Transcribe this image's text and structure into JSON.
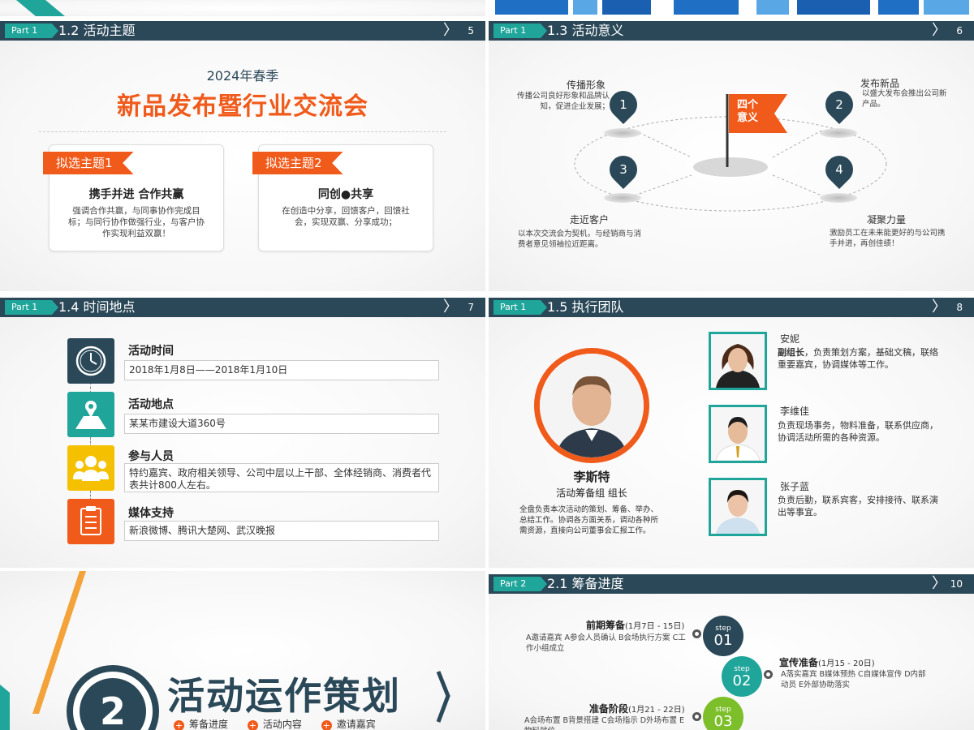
{
  "header_common": {
    "part1": "Part 1",
    "part2": "Part 2"
  },
  "slide5": {
    "title": "1.2 活动主题",
    "number": "5",
    "subtitle": "2024年春季",
    "main_title": "新品发布暨行业交流会",
    "cards": [
      {
        "tag": "拟选主题1",
        "heading": "携手并进  合作共赢",
        "text": "强调合作共赢，与同事协作完成目标；与同行协作做强行业，与客户协作实现利益双赢！"
      },
      {
        "tag": "拟选主题2",
        "heading": "同创●共享",
        "text": "在创造中分享，回馈客户，回馈社会，实现双赢、分享成功；"
      }
    ]
  },
  "slide6": {
    "title": "1.3 活动意义",
    "number": "6",
    "flag": "四个意义",
    "points": [
      {
        "num": "1",
        "label": "传播形象",
        "text": "传播公司良好形象和品牌认知，促进企业发展；"
      },
      {
        "num": "2",
        "label": "发布新品",
        "text": "以盛大发布会推出公司新产品。"
      },
      {
        "num": "3",
        "label": "走近客户",
        "text": "以本次交流会为契机，与经销商与消费者意见领袖拉近距离。"
      },
      {
        "num": "4",
        "label": "凝聚力量",
        "text": "激励员工在未来能更好的与公司携手并进，再创佳绩！"
      }
    ]
  },
  "slide7": {
    "title": "1.4 时间地点",
    "number": "7",
    "items": [
      {
        "label": "活动时间",
        "value": "2018年1月8日——2018年1月10日",
        "icon": "clock-icon",
        "color": "#2a4858"
      },
      {
        "label": "活动地点",
        "value": "某某市建设大道360号",
        "icon": "map-pin-icon",
        "color": "#1fa59a"
      },
      {
        "label": "参与人员",
        "value": "特约嘉宾、政府相关领导、公司中层以上干部、全体经销商、消费者代表共计800人左右。",
        "icon": "people-icon",
        "color": "#f5c000"
      },
      {
        "label": "媒体支持",
        "value": "新浪微博、腾讯大楚网、武汉晚报",
        "icon": "clipboard-icon",
        "color": "#f05a1a"
      }
    ]
  },
  "slide8": {
    "title": "1.5 执行团队",
    "number": "8",
    "leader": {
      "name": "李斯特",
      "role": "活动筹备组  组长",
      "desc": "全盘负责本次活动的策划、筹备、举办、总结工作。协调各方面关系，调动各种所需资源，直接向公司董事会汇报工作。"
    },
    "members": [
      {
        "name": "安妮",
        "role": "副组长",
        "desc": "，负责策划方案，基础文稿，联络重要嘉宾，协调媒体等工作。"
      },
      {
        "name": "李维佳",
        "role": "",
        "desc": "负责现场事务，物料准备，联系供应商，协调活动所需的各种资源。"
      },
      {
        "name": "张子蓝",
        "role": "",
        "desc": "负责后勤，联系宾客，安排接待、联系演出等事宜。"
      }
    ]
  },
  "slide9": {
    "number": "2",
    "title": "活动运作策划",
    "bullets": [
      "筹备进度",
      "活动内容",
      "邀请嘉宾"
    ]
  },
  "slide10": {
    "title": "2.1 筹备进度",
    "number": "10",
    "steps": [
      {
        "st": "step",
        "num": "01",
        "title": "前期筹备",
        "date": "(1月7日 - 15日)",
        "text": "A邀请嘉宾  A参会人员确认  B会场执行方案  C工作小组成立",
        "color": "#2a4858"
      },
      {
        "st": "step",
        "num": "02",
        "title": "宣传准备",
        "date": "(1月15 - 20日)",
        "text": "A落实嘉宾  B媒体预热  C自媒体宣传  D内部动员  E外部协助落实",
        "color": "#1fa59a"
      },
      {
        "st": "step",
        "num": "03",
        "title": "准备阶段",
        "date": "(1月21 - 22日)",
        "text": "A会场布置  B背景搭建  C会场指示  D外场布置  E物料就位",
        "color": "#7cbf2a"
      }
    ]
  }
}
